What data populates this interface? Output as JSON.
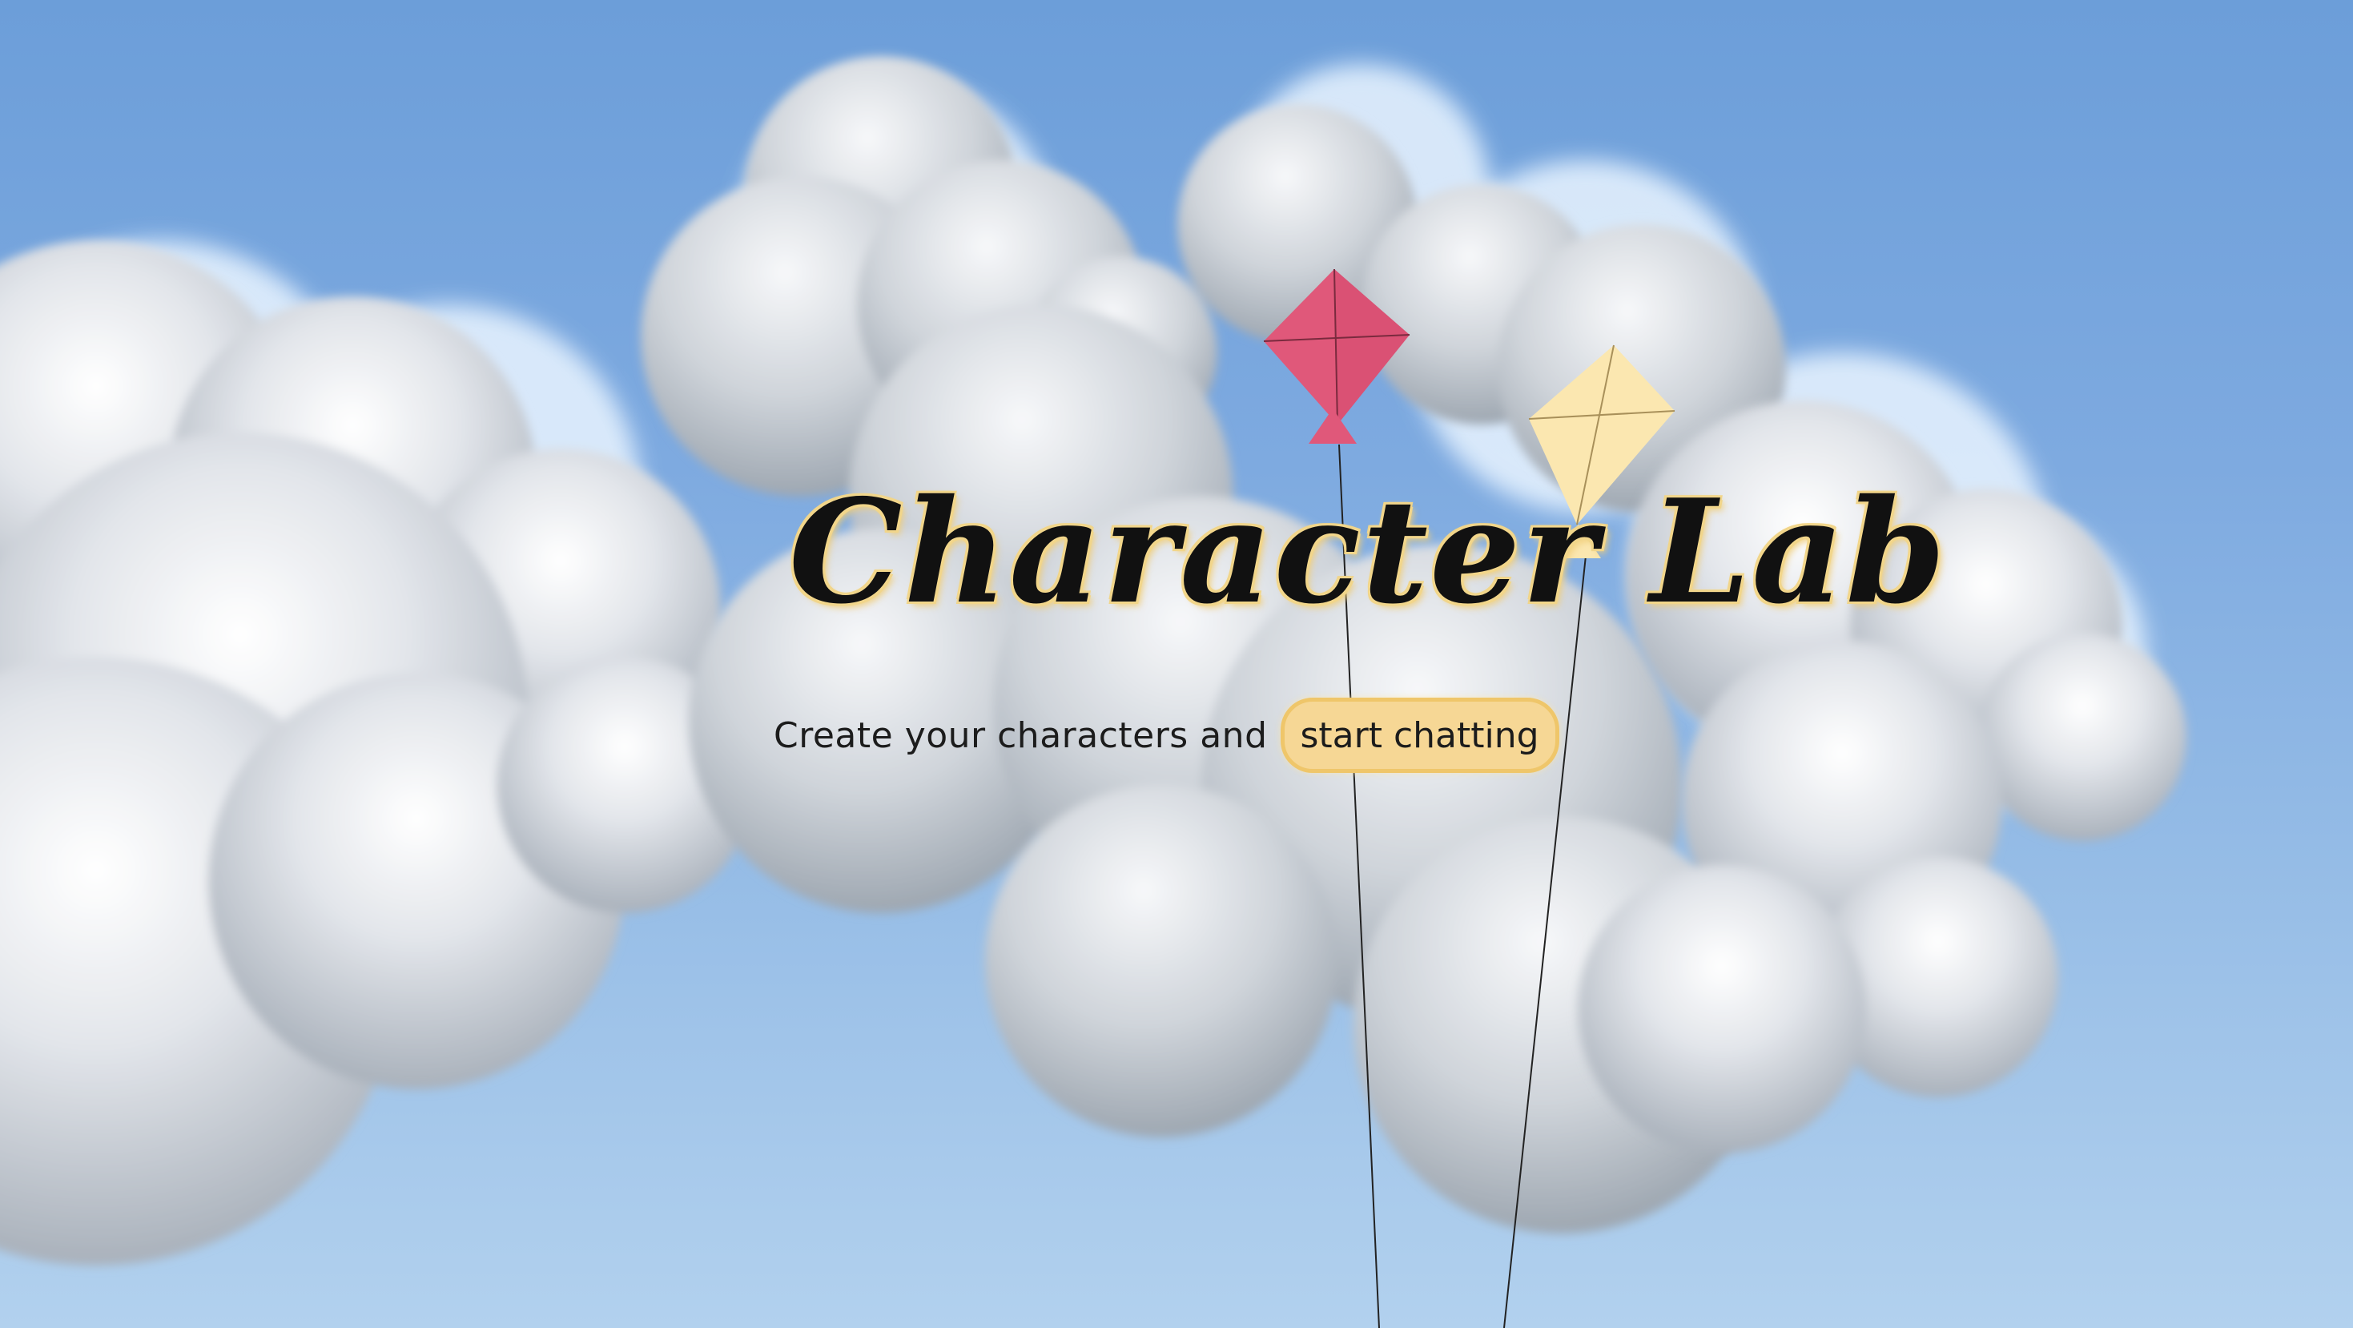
{
  "hero": {
    "title": "Character Lab",
    "subtitle": "Create your characters and",
    "cta_label": "start chatting"
  },
  "decorations": {
    "kites": [
      {
        "name": "kite-pink",
        "color": "#e0587a"
      },
      {
        "name": "kite-yellow",
        "color": "#fbe7b0"
      }
    ],
    "clouds_color": "#c9ced6",
    "sky_top": "#6c9ed9",
    "sky_bottom": "#b2d1ee"
  },
  "colors": {
    "cta_background": "#f6d795",
    "cta_border": "#efc66a",
    "title_glow": "#f1d58a"
  }
}
